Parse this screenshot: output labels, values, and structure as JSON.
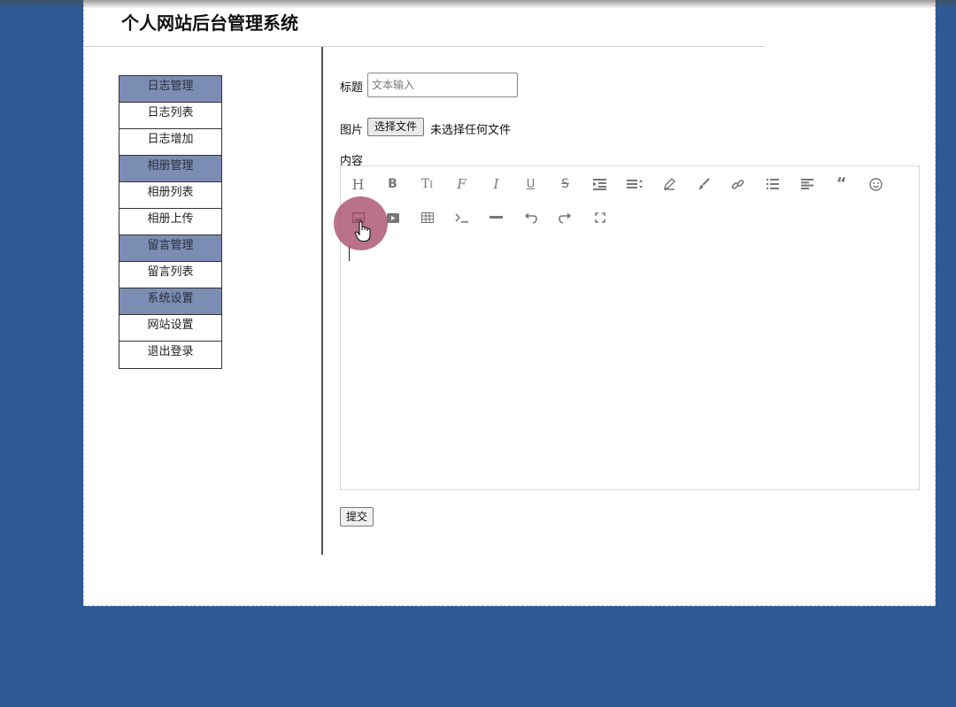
{
  "header": {
    "title": "个人网站后台管理系统"
  },
  "sidebar": {
    "items": [
      {
        "label": "日志管理",
        "type": "group"
      },
      {
        "label": "日志列表",
        "type": "link"
      },
      {
        "label": "日志增加",
        "type": "link"
      },
      {
        "label": "相册管理",
        "type": "group"
      },
      {
        "label": "相册列表",
        "type": "link"
      },
      {
        "label": "相册上传",
        "type": "link"
      },
      {
        "label": "留言管理",
        "type": "group"
      },
      {
        "label": "留言列表",
        "type": "link"
      },
      {
        "label": "系统设置",
        "type": "group"
      },
      {
        "label": "网站设置",
        "type": "link"
      },
      {
        "label": "退出登录",
        "type": "link"
      }
    ]
  },
  "form": {
    "title_label": "标题",
    "title_placeholder": "文本输入",
    "title_value": "",
    "image_label": "图片",
    "file_button": "选择文件",
    "file_status": "未选择任何文件",
    "content_label": "内容",
    "submit_label": "提交"
  },
  "toolbar": {
    "row1": [
      "heading-icon",
      "bold-icon",
      "font-size-icon",
      "font-family-icon",
      "italic-icon",
      "underline-icon",
      "strikethrough-icon",
      "indent-icon",
      "line-height-icon",
      "pen-icon",
      "brush-icon",
      "link-icon",
      "list-icon",
      "align-icon",
      "quote-icon",
      "emoji-icon"
    ],
    "row2": [
      "image-icon",
      "video-icon",
      "table-icon",
      "code-icon",
      "divider-icon",
      "undo-icon",
      "redo-icon",
      "fullscreen-icon"
    ]
  },
  "colors": {
    "background": "#2d5a94",
    "sidebar_group": "#7b8db3",
    "click_indicator": "#a03c5f"
  }
}
